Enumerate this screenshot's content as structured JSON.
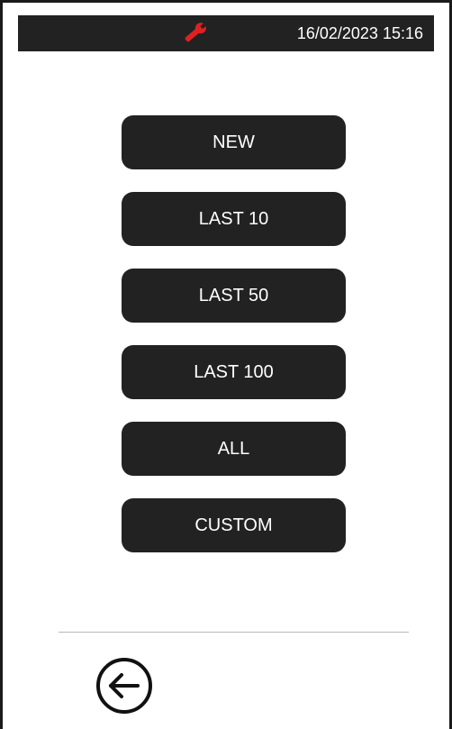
{
  "status_bar": {
    "icon": "wrench-icon",
    "icon_color": "#e02020",
    "datetime": "16/02/2023 15:16",
    "background": "#222222"
  },
  "menu": {
    "items": [
      {
        "label": "NEW"
      },
      {
        "label": "LAST 10"
      },
      {
        "label": "LAST 50"
      },
      {
        "label": "LAST 100"
      },
      {
        "label": "ALL"
      },
      {
        "label": "CUSTOM"
      }
    ],
    "button_color": "#222222",
    "text_color": "#ffffff"
  },
  "footer": {
    "back_icon": "arrow-left-circle-icon"
  }
}
